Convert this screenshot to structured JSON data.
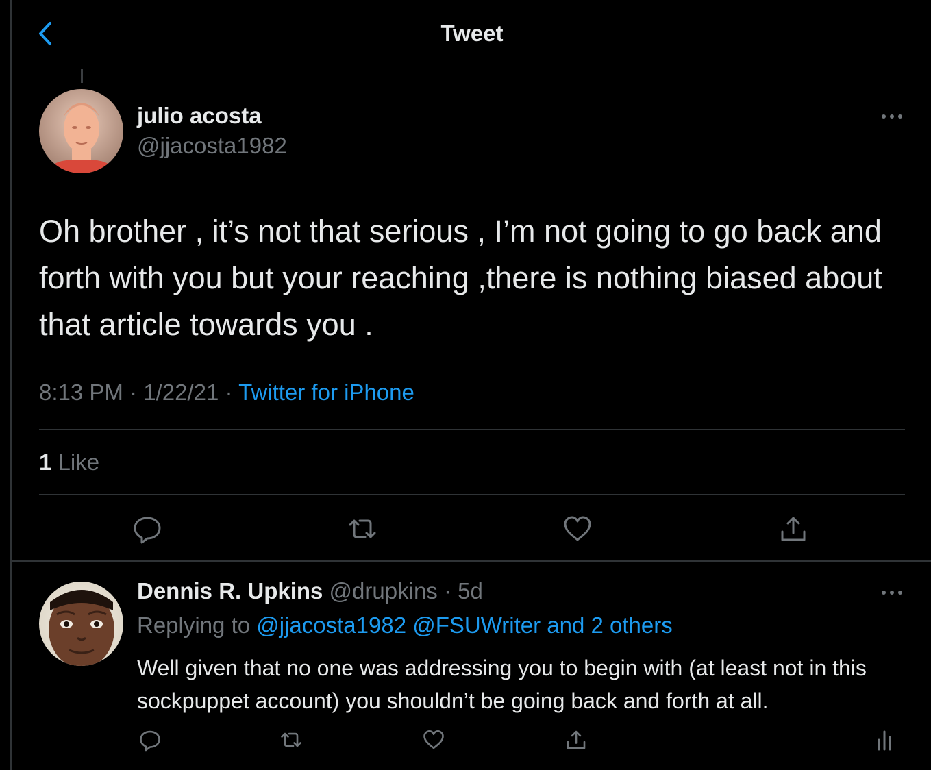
{
  "header": {
    "title": "Tweet"
  },
  "main_tweet": {
    "name": "julio acosta",
    "handle": "@jjacosta1982",
    "text": "Oh brother , it’s not that serious , I’m not going to go back and forth with you but your reaching ,there is nothing biased about that article towards you .",
    "time": "8:13 PM",
    "date": "1/22/21",
    "separator": " · ",
    "source": "Twitter for iPhone",
    "likes_count": "1",
    "likes_label": " Like"
  },
  "reply": {
    "name": "Dennis R. Upkins",
    "handle_time": " @drupkins · 5d",
    "replying_prefix": "Replying to ",
    "replying_links": "@jjacosta1982 @FSUWriter and 2 others",
    "text": "Well given that no one was addressing you to begin with (at least not in this sockpuppet account) you shouldn’t be going back and forth at all."
  },
  "colors": {
    "background": "#000000",
    "accent": "#1d9bf0",
    "muted": "#71767b",
    "divider": "#2f3336"
  },
  "icons": [
    "chevron-left-icon",
    "more-icon",
    "reply-icon",
    "retweet-icon",
    "like-icon",
    "share-icon",
    "analytics-icon"
  ]
}
